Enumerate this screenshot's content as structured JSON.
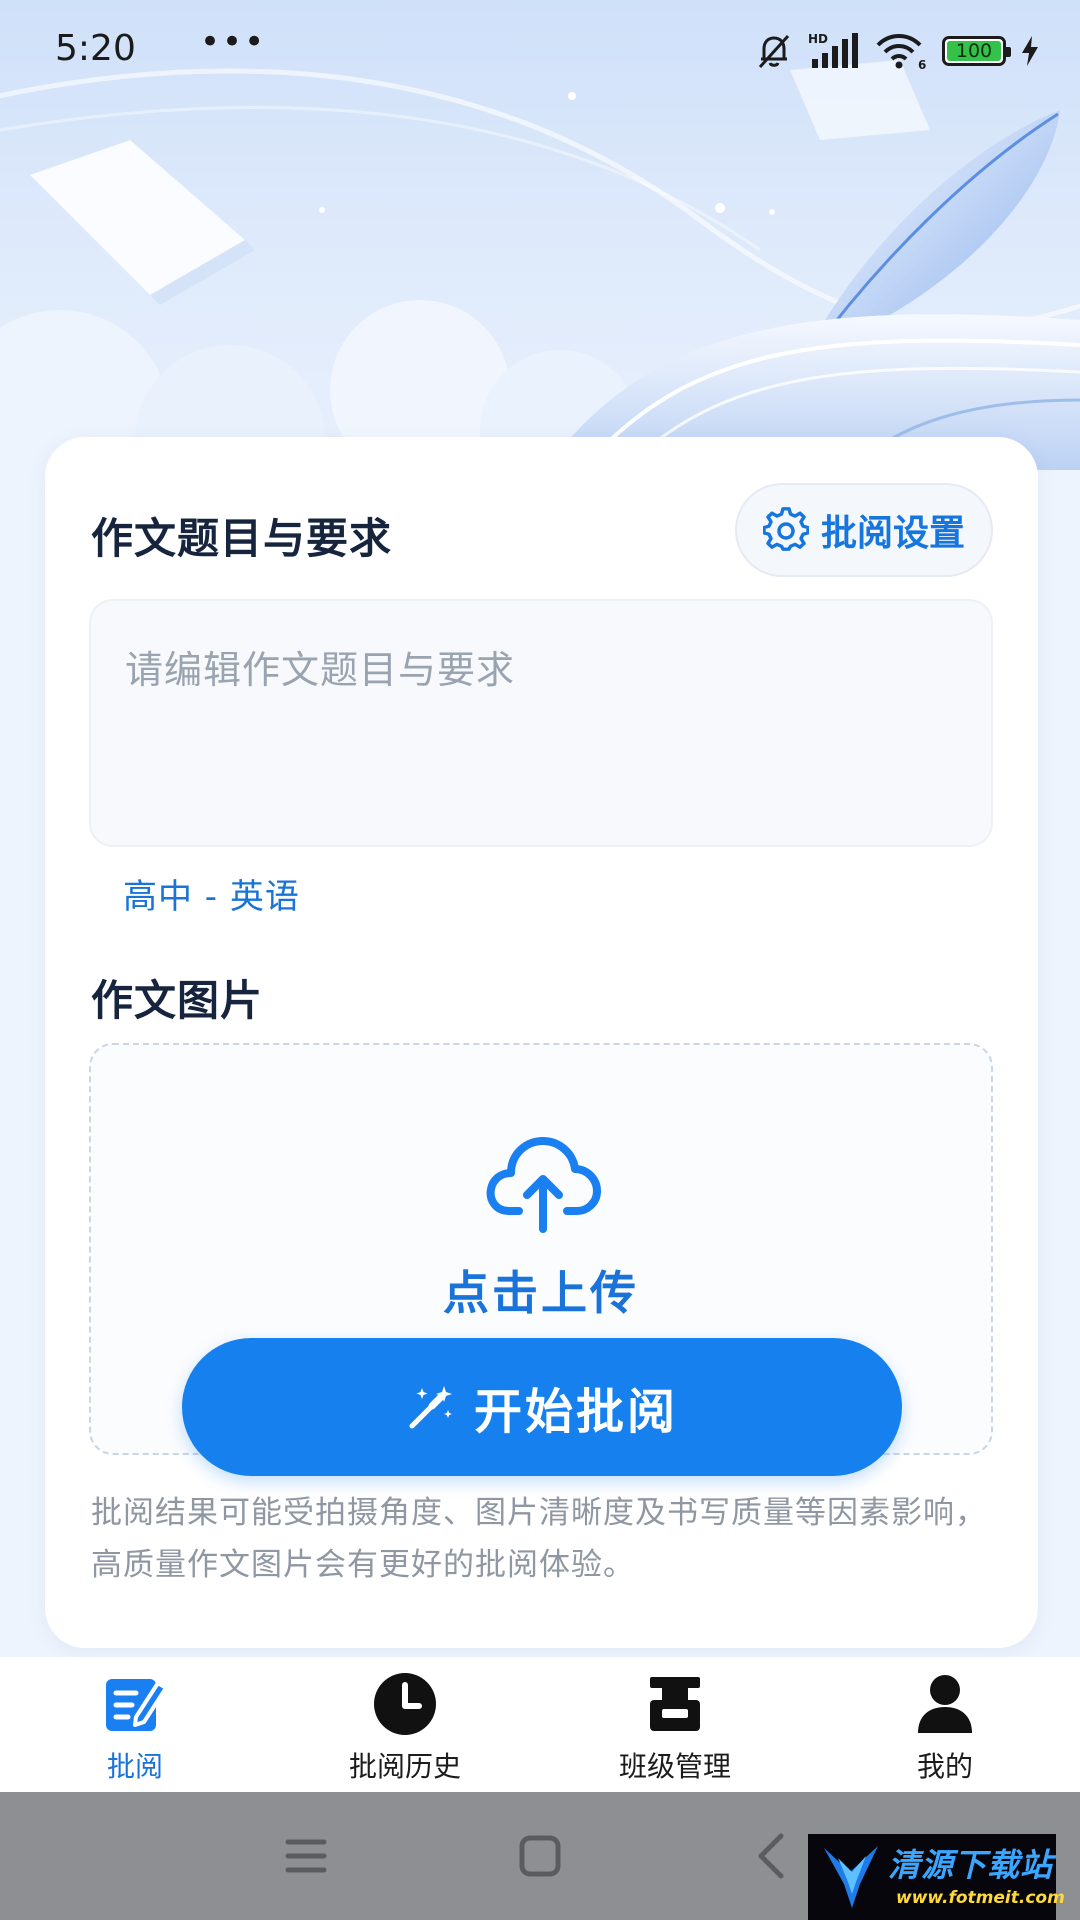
{
  "status_bar": {
    "time": "5:20",
    "more": "•••",
    "network_label": "HD",
    "wifi_badge": "6",
    "battery": "100"
  },
  "form": {
    "topic_title": "作文题目与要求",
    "settings_label": "批阅设置",
    "topic_placeholder": "请编辑作文题目与要求",
    "grade_subject": "高中 - 英语",
    "image_title": "作文图片",
    "upload_label": "点击上传",
    "start_label": "开始批阅",
    "disclaimer": "批阅结果可能受拍摄角度、图片清晰度及书写质量等因素影响，高质量作文图片会有更好的批阅体验。"
  },
  "bottom_nav": {
    "items": [
      {
        "label": "批阅",
        "icon": "edit-document-icon",
        "active": true
      },
      {
        "label": "批阅历史",
        "icon": "clock-icon",
        "active": false
      },
      {
        "label": "班级管理",
        "icon": "class-icon",
        "active": false
      },
      {
        "label": "我的",
        "icon": "person-icon",
        "active": false
      }
    ]
  },
  "watermark": {
    "title": "清源下载站",
    "url": "www.fotmeit.com"
  },
  "colors": {
    "accent": "#1681ee",
    "accent_text": "#1a73d9",
    "hero": "#cfe0f9"
  }
}
